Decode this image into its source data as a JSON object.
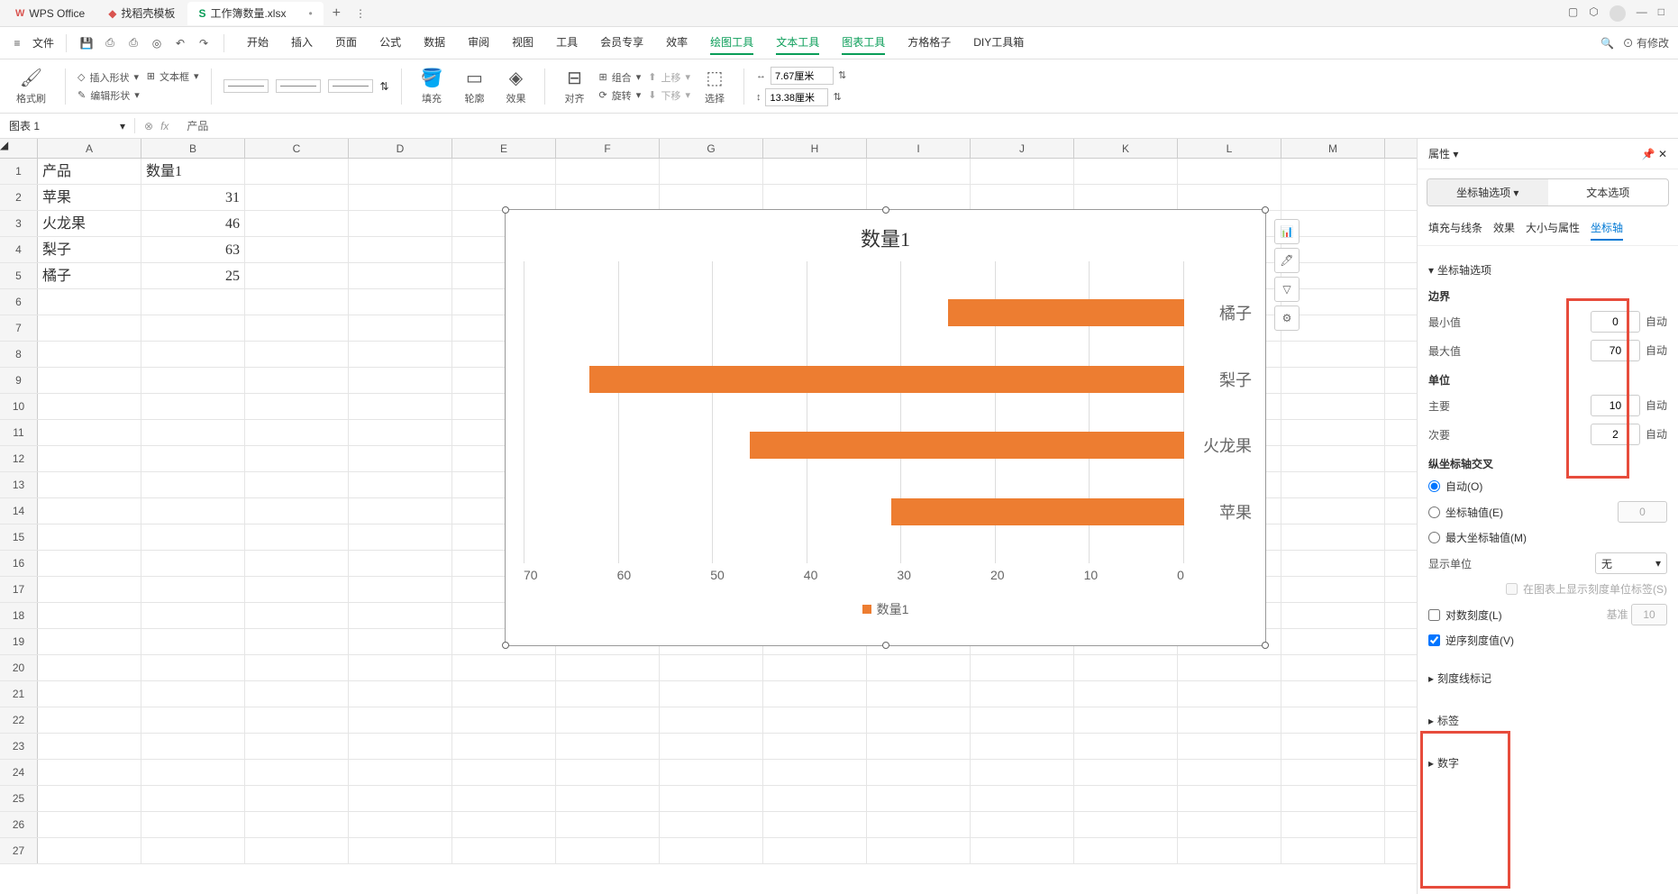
{
  "tabs": {
    "wps": "WPS Office",
    "template": "找稻壳模板",
    "file": "工作簿数量.xlsx"
  },
  "menu": {
    "file": "文件",
    "items": [
      "开始",
      "插入",
      "页面",
      "公式",
      "数据",
      "审阅",
      "视图",
      "工具",
      "会员专享",
      "效率",
      "绘图工具",
      "文本工具",
      "图表工具",
      "方格格子",
      "DIY工具箱"
    ],
    "modified": "有修改"
  },
  "toolbar": {
    "format": "格式刷",
    "insert_shape": "插入形状",
    "textbox": "文本框",
    "edit_shape": "编辑形状",
    "fill": "填充",
    "outline": "轮廓",
    "effect": "效果",
    "align": "对齐",
    "group": "组合",
    "rotate": "旋转",
    "move_up": "上移",
    "move_down": "下移",
    "select": "选择",
    "width_val": "7.67厘米",
    "height_val": "13.38厘米"
  },
  "name_box": "图表 1",
  "formula": "产品",
  "columns": [
    "A",
    "B",
    "C",
    "D",
    "E",
    "F",
    "G",
    "H",
    "I",
    "J",
    "K",
    "L",
    "M"
  ],
  "sheet": {
    "header": [
      "产品",
      "数量1"
    ],
    "rows": [
      {
        "product": "苹果",
        "qty": "31"
      },
      {
        "product": "火龙果",
        "qty": "46"
      },
      {
        "product": "梨子",
        "qty": "63"
      },
      {
        "product": "橘子",
        "qty": "25"
      }
    ]
  },
  "chart_data": {
    "type": "bar",
    "title": "数量1",
    "categories": [
      "橘子",
      "梨子",
      "火龙果",
      "苹果"
    ],
    "values": [
      25,
      63,
      46,
      31
    ],
    "xlim": [
      0,
      70
    ],
    "x_reversed": true,
    "ticks": [
      70,
      60,
      50,
      40,
      30,
      20,
      10,
      0
    ],
    "legend": "数量1"
  },
  "props": {
    "title": "属性",
    "tab1": "坐标轴选项",
    "tab2": "文本选项",
    "subtabs": [
      "填充与线条",
      "效果",
      "大小与属性",
      "坐标轴"
    ],
    "axis_options": "坐标轴选项",
    "bounds": "边界",
    "min": "最小值",
    "min_val": "0",
    "max": "最大值",
    "max_val": "70",
    "unit": "单位",
    "major": "主要",
    "major_val": "10",
    "minor": "次要",
    "minor_val": "2",
    "auto": "自动",
    "vcross": "纵坐标轴交叉",
    "auto_o": "自动(O)",
    "axis_val": "坐标轴值(E)",
    "axis_val_v": "0",
    "max_axis": "最大坐标轴值(M)",
    "display_unit": "显示单位",
    "none": "无",
    "show_label": "在图表上显示刻度单位标签(S)",
    "log": "对数刻度(L)",
    "base": "基准",
    "base_val": "10",
    "reverse": "逆序刻度值(V)",
    "tick_marks": "刻度线标记",
    "labels": "标签",
    "numbers": "数字"
  }
}
